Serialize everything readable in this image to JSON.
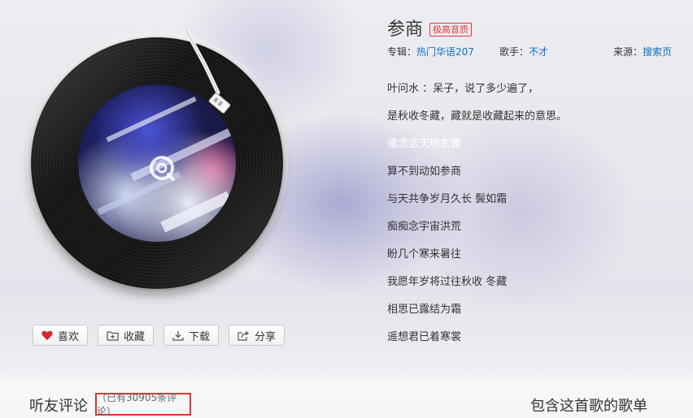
{
  "song": {
    "title": "参商",
    "quality_badge": "极高音质",
    "album_label": "专辑：",
    "album": "热门华语207",
    "singer_label": "歌手：",
    "singer": "不才",
    "source_label": "来源：",
    "source": "搜索页"
  },
  "actions": {
    "like": "喜欢",
    "collect": "收藏",
    "download": "下载",
    "share": "分享"
  },
  "lyrics": [
    "叶问水 ：呆子，说了多少遍了，",
    "是秋收冬藏，藏就是收藏起来的意思。",
    "谁念这天地玄黄",
    "算不到动如参商",
    "与天共争岁月久长 鬓如霜",
    "痴痴念宇宙洪荒",
    "盼几个寒来暑往",
    "我愿年岁将过往秋收 冬藏",
    "相思已露结为霜",
    "遥想君已着寒裳"
  ],
  "active_lyric_index": 2,
  "comments": {
    "heading": "听友评论",
    "count_text": "（已有30905条评论）"
  },
  "playlists": {
    "heading": "包含这首歌的歌单"
  },
  "colors": {
    "link": "#0c73c2",
    "badge": "#e13a3a",
    "highlight_box": "#e03333",
    "heart": "#d8262c"
  },
  "icons": {
    "like": "heart-icon",
    "collect": "add-folder-icon",
    "download": "download-icon",
    "share": "share-icon",
    "center": "music-logo-icon"
  }
}
